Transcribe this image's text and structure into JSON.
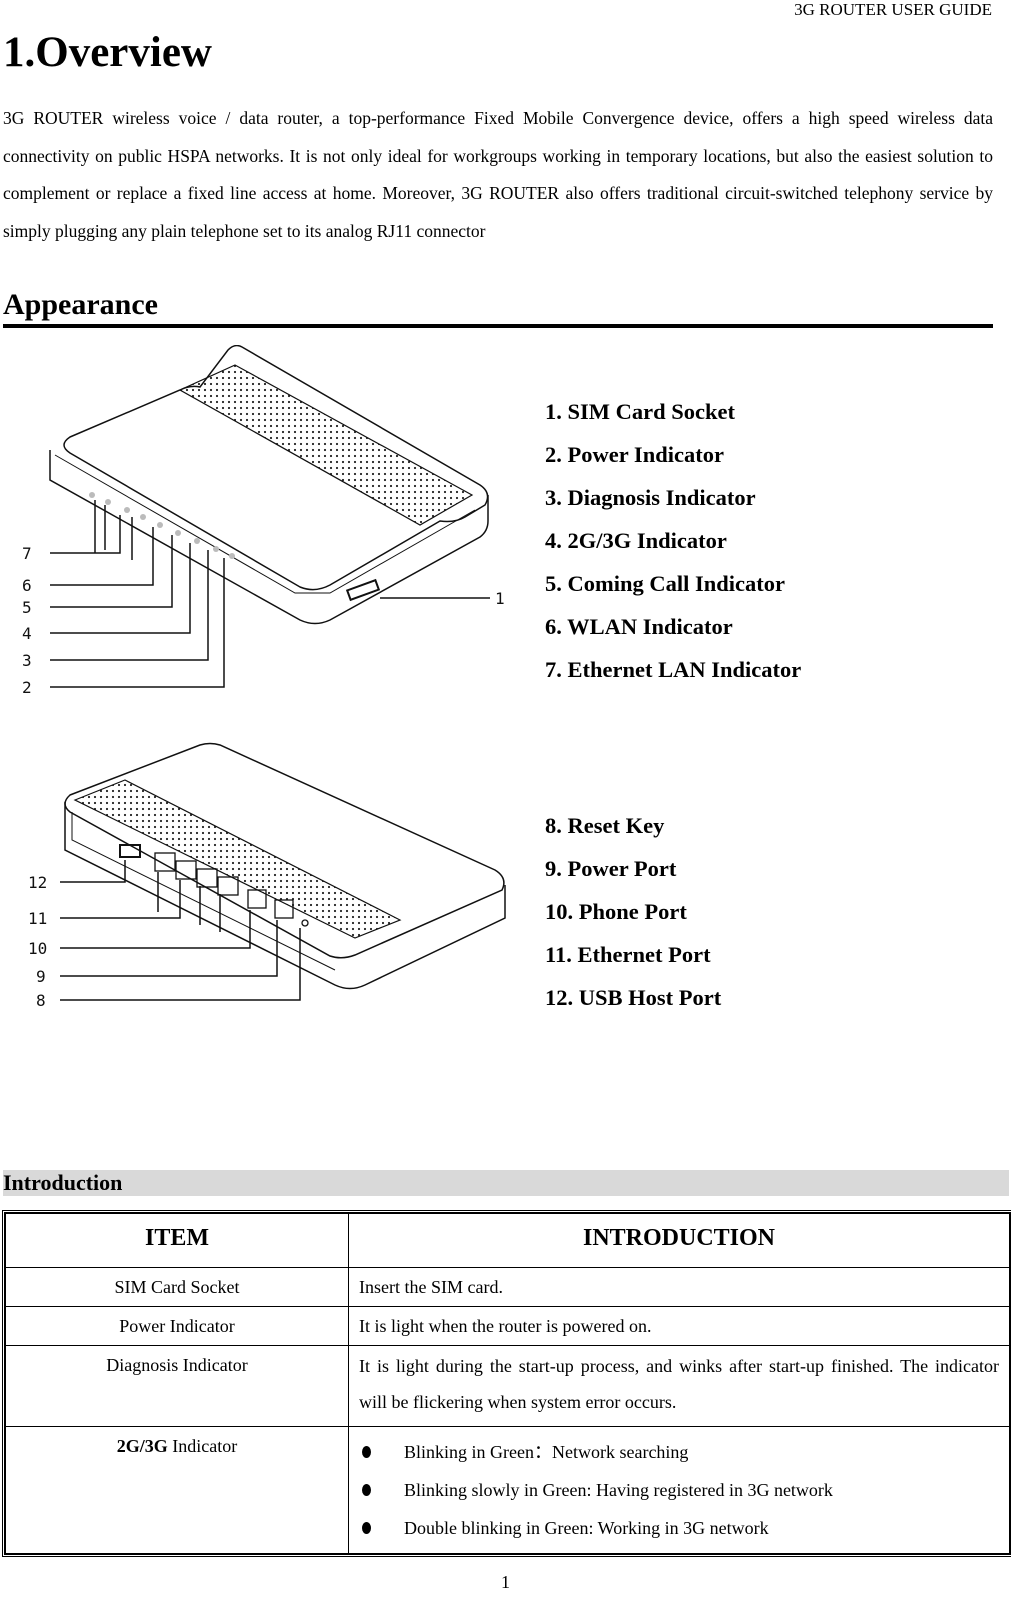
{
  "header": {
    "running_title": "3G ROUTER USER GUIDE"
  },
  "overview": {
    "title": "1.Overview",
    "paragraph": "3G ROUTER wireless voice / data router, a top-performance Fixed Mobile Convergence device, offers a high speed wireless data connectivity on public HSPA networks. It is not only ideal for workgroups working in temporary locations, but also the easiest solution to complement or replace a fixed line access at home. Moreover, 3G ROUTER also offers traditional circuit-switched telephony service by simply plugging any plain telephone set to its analog RJ11 connector"
  },
  "appearance": {
    "title": "Appearance",
    "front_figure": {
      "callout_numbers": [
        "7",
        "6",
        "5",
        "4",
        "3",
        "2",
        "1"
      ],
      "legend": [
        "1. SIM Card Socket",
        "2. Power Indicator",
        "3. Diagnosis Indicator",
        "4. 2G/3G Indicator",
        "5. Coming Call Indicator",
        "6. WLAN Indicator",
        "7. Ethernet LAN Indicator"
      ]
    },
    "back_figure": {
      "callout_numbers": [
        "12",
        "11",
        "10",
        "9",
        "8"
      ],
      "legend": [
        "8. Reset Key",
        "9. Power Port",
        "10. Phone Port",
        "11. Ethernet Port",
        "12. USB Host Port"
      ]
    }
  },
  "introduction": {
    "title": "Introduction",
    "table": {
      "headers": [
        "ITEM",
        "INTRODUCTION"
      ],
      "rows": [
        {
          "item": "SIM Card Socket",
          "text": "Insert the SIM card."
        },
        {
          "item": "Power Indicator",
          "text": "It is light when the router is powered on."
        },
        {
          "item": "Diagnosis Indicator",
          "text": "It is light during the start-up process, and winks after start-up finished. The indicator will be flickering when system error occurs."
        },
        {
          "item_bold": "2G/3G",
          "item_rest": " Indicator",
          "bullets": [
            "Blinking in Green：Network searching",
            "Blinking slowly in Green: Having registered in 3G network",
            "Double blinking in Green: Working in 3G network"
          ]
        }
      ]
    }
  },
  "footer": {
    "page_number": "1"
  }
}
